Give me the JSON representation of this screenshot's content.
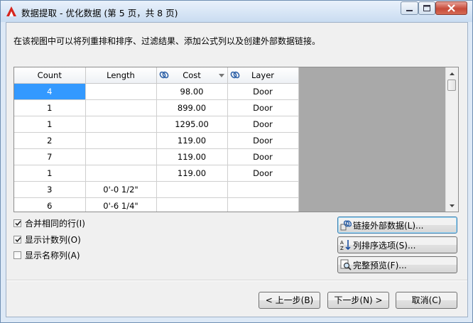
{
  "window": {
    "title": "数据提取 - 优化数据 (第 5 页，共 8 页)"
  },
  "description": "在该视图中可以将列重排和排序、过滤结果、添加公式列以及创建外部数据链接。",
  "grid": {
    "columns": [
      "Count",
      "Length",
      "Cost",
      "Layer"
    ],
    "rows": [
      [
        "4",
        "",
        "98.00",
        "Door"
      ],
      [
        "1",
        "",
        "899.00",
        "Door"
      ],
      [
        "1",
        "",
        "1295.00",
        "Door"
      ],
      [
        "2",
        "",
        "119.00",
        "Door"
      ],
      [
        "7",
        "",
        "119.00",
        "Door"
      ],
      [
        "1",
        "",
        "119.00",
        "Door"
      ],
      [
        "3",
        "0'-0 1/2\"",
        "",
        ""
      ],
      [
        "6",
        "0'-6 1/4\"",
        "",
        ""
      ]
    ]
  },
  "options": {
    "merge_rows": {
      "label": "合并相同的行(I)",
      "checked": true
    },
    "show_count": {
      "label": "显示计数列(O)",
      "checked": true
    },
    "show_name": {
      "label": "显示名称列(A)",
      "checked": false
    }
  },
  "actions": {
    "link_external": "链接外部数据(L)...",
    "sort_options": "列排序选项(S)...",
    "full_preview": "完整预览(F)..."
  },
  "nav": {
    "back": "< 上一步(B)",
    "next": "下一步(N) >",
    "cancel": "取消(C)"
  }
}
